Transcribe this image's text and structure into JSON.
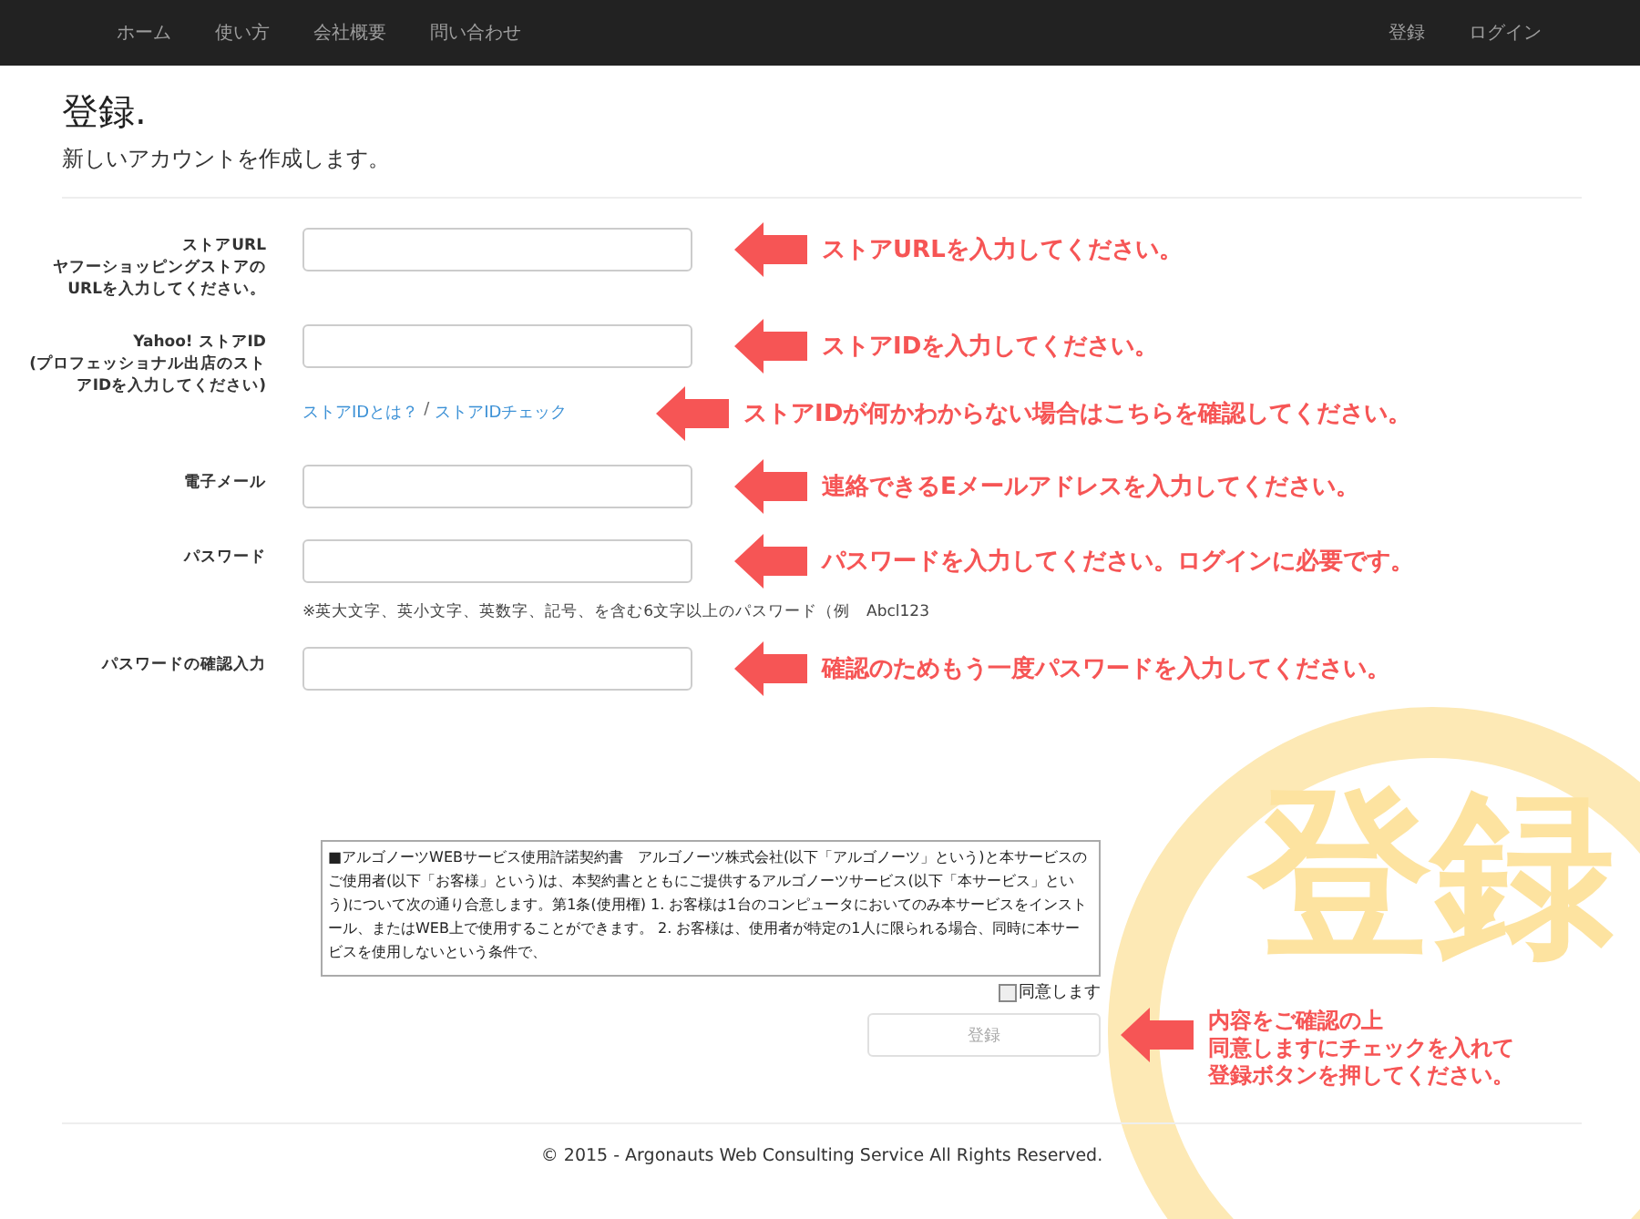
{
  "navbar": {
    "left_items": [
      "ホーム",
      "使い方",
      "会社概要",
      "問い合わせ"
    ],
    "right_items": [
      "登録",
      "ログイン"
    ]
  },
  "header": {
    "title": "登録.",
    "subtitle": "新しいアカウントを作成します。"
  },
  "fields": [
    {
      "label": "ストアURL\nヤフーショッピングストアの\nURLを入力してください。",
      "callout": "ストアURLを入力してください。"
    },
    {
      "label": "Yahoo! ストアID\n(プロフェッショナル出店のストアIDを入力してください)",
      "callout": "ストアIDを入力してください。",
      "links": [
        "ストアIDとは？",
        "ストアIDチェック"
      ],
      "link_separator": "/",
      "links_callout": "ストアIDが何かわからない場合はこちらを確認してください。"
    },
    {
      "label": "電子メール",
      "callout": "連絡できるEメールアドレスを入力してください。"
    },
    {
      "label": "パスワード",
      "callout": "パスワードを入力してください。ログインに必要です。",
      "note": "※英大文字、英小文字、英数字、記号、を含む6文字以上のパスワード（例　Abcl123"
    },
    {
      "label": "パスワードの確認入力",
      "callout": "確認のためもう一度パスワードを入力してください。"
    }
  ],
  "agreement": {
    "text": "■アルゴノーツWEBサービス使用許諾契約書　アルゴノーツ株式会社(以下「アルゴノーツ」という)と本サービスのご使用者(以下「お客様」という)は、本契約書とともにご提供するアルゴノーツサービス(以下「本サービス」という)について次の通り合意します。第1条(使用権) 1. お客様は1台のコンピュータにおいてのみ本サービスをインストール、またはWEB上で使用することができます。 2. お客様は、使用者が特定の1人に限られる場合、同時に本サービスを使用しないという条件で、",
    "checkbox_label": "同意します",
    "checked": false
  },
  "submit": {
    "label": "登録",
    "disabled": true,
    "callout_lines": [
      "内容をご確認の上",
      "同意しますにチェックを入れて",
      "登録ボタンを押してください。"
    ]
  },
  "stamp": {
    "text": "登録"
  },
  "footer": "© 2015 - Argonauts Web Consulting Service All Rights Reserved."
}
